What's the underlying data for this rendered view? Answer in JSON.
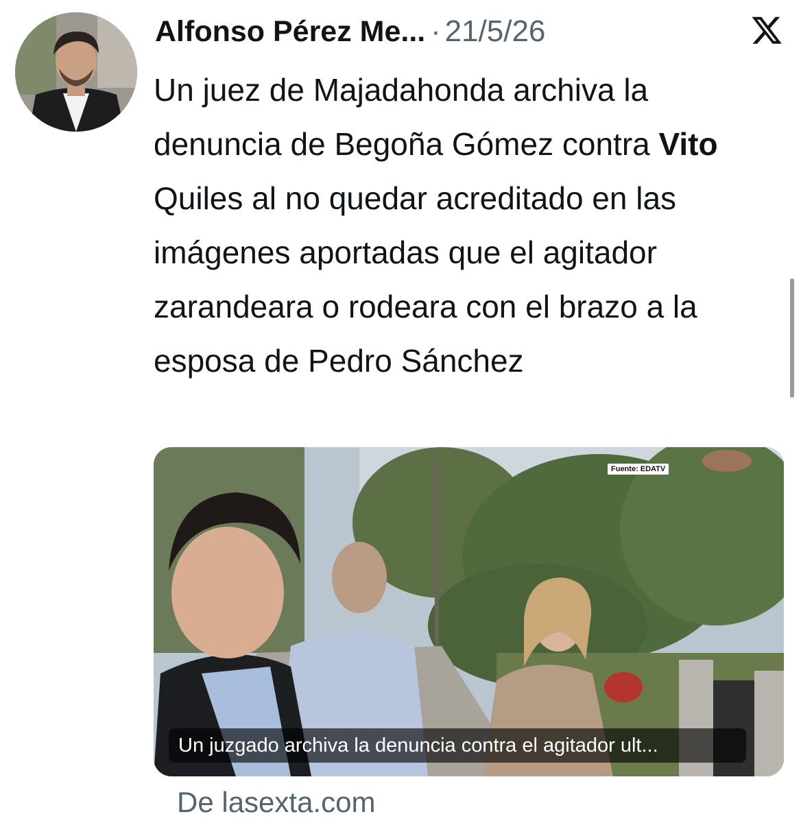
{
  "author": {
    "display_name": "Alfonso Pérez Me...",
    "separator": "·",
    "date": "21/5/26"
  },
  "tweet": {
    "text_bold": "Vito",
    "text_before": "Un juez de Majadahonda archiva la denuncia de Begoña Gómez contra ",
    "text_after": " Quiles al no quedar acreditado en las imágenes aportadas que el agitador zarandeara o rodeara con el brazo a la esposa de Pedro Sánchez"
  },
  "media": {
    "source_tag": "Fuente: EDATV",
    "caption": "Un juzgado archiva la denuncia contra el agitador ult..."
  },
  "link": {
    "source_text": "De lasexta.com"
  },
  "icons": {
    "platform_logo": "x-logo-icon",
    "avatar": "avatar"
  },
  "colors": {
    "text_primary": "#0f1419",
    "text_secondary": "#536471",
    "background": "#ffffff"
  }
}
